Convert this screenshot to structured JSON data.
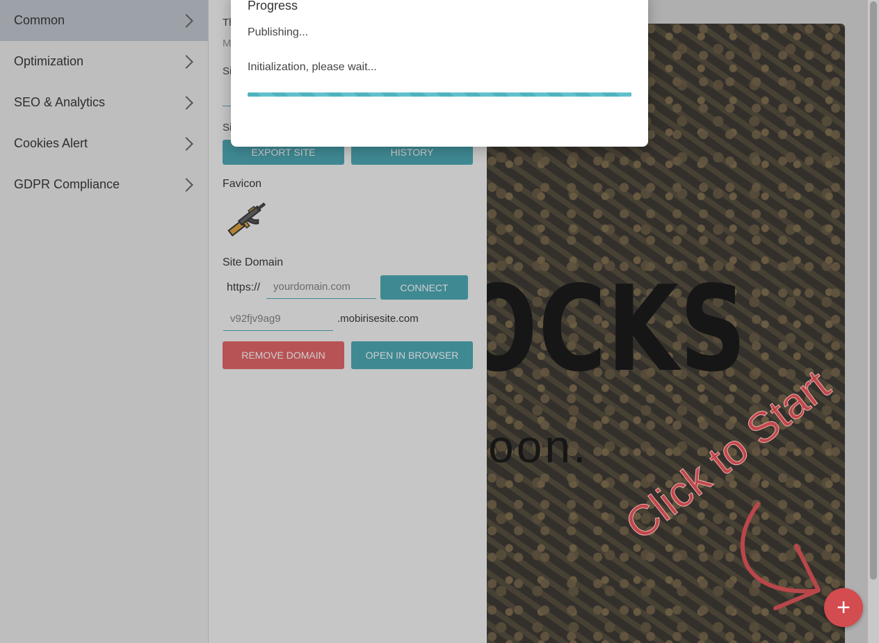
{
  "sidebar": {
    "items": [
      {
        "label": "Common",
        "active": true
      },
      {
        "label": "Optimization",
        "active": false
      },
      {
        "label": "SEO & Analytics",
        "active": false
      },
      {
        "label": "Cookies Alert",
        "active": false
      },
      {
        "label": "GDPR Compliance",
        "active": false
      }
    ]
  },
  "panel": {
    "partial_labels": [
      "Th",
      "M",
      "Si",
      "Si"
    ],
    "export_label": "EXPORT SITE",
    "history_label": "HISTORY",
    "favicon_label": "Favicon",
    "favicon_icon": "rifle-icon",
    "site_domain_label": "Site Domain",
    "https_prefix": "https://",
    "domain_placeholder": "yourdomain.com",
    "connect_label": "CONNECT",
    "subdomain_value": "v92fjv9ag9",
    "subdomain_suffix": ".mobirisesite.com",
    "remove_domain_label": "REMOVE DOMAIN",
    "open_browser_label": "OPEN IN BROWSER"
  },
  "preview": {
    "hero_title": "OCKS",
    "hero_subtitle": "oon.",
    "click_to_start": "Click to Start",
    "fab_symbol": "+"
  },
  "modal": {
    "title": "Progress",
    "status": "Publishing...",
    "detail": "Initialization, please wait...",
    "progress": 1.0
  },
  "colors": {
    "accent": "#3aa0ad",
    "danger": "#e15558",
    "sidebar_active": "#bcc2cc"
  }
}
